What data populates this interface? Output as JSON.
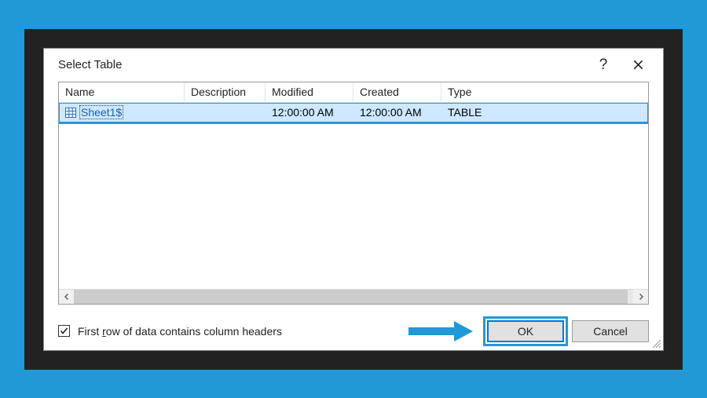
{
  "dialog": {
    "title": "Select Table",
    "help_tooltip": "?",
    "columns": {
      "name": "Name",
      "description": "Description",
      "modified": "Modified",
      "created": "Created",
      "type": "Type"
    },
    "rows": [
      {
        "name": "Sheet1$",
        "description": "",
        "modified": "12:00:00 AM",
        "created": "12:00:00 AM",
        "type": "TABLE",
        "selected": true
      }
    ],
    "scrollbar_thumb_pct": "99",
    "checkbox": {
      "checked": true,
      "label_pre": "First ",
      "label_accel": "r",
      "label_post": "ow of data contains column headers"
    },
    "buttons": {
      "ok": "OK",
      "cancel": "Cancel"
    }
  },
  "annotation": {
    "arrow_color": "#2199d6"
  }
}
